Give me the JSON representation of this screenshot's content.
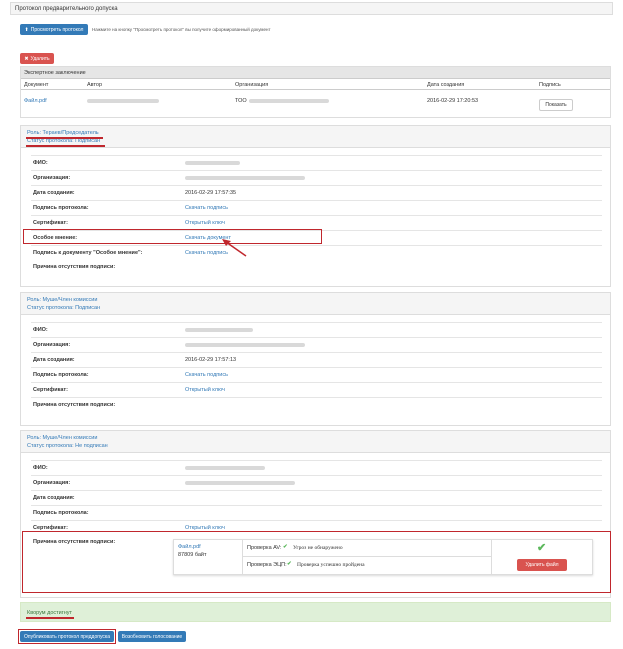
{
  "panel": {
    "title": "Протокол предварительного допуска"
  },
  "toolbar": {
    "view_label": "Просмотреть протокол",
    "view_hint": "Нажмите на кнопку \"Просмотреть протокол\" вы получите оформированный документ"
  },
  "expert": {
    "delete_label": "Удалить",
    "title": "Экспертное заключение",
    "columns": [
      "Документ",
      "Автор",
      "Организация",
      "Дата создания",
      "Подпись"
    ],
    "row": {
      "doc": "Файл.pdf",
      "org_prefix": "ТОО",
      "date": "2016-02-29 17:20:53",
      "sign_label": "Показать"
    }
  },
  "members": [
    {
      "role_label": "Роль:",
      "role_value": "Тераев/Председатель",
      "status_label": "Статус протокола:",
      "status_value": "Подписан",
      "rows": [
        {
          "label": "ФИО:",
          "value": ""
        },
        {
          "label": "Организация:",
          "value": ""
        },
        {
          "label": "Дата создания:",
          "value": "2016-02-29 17:57:35"
        },
        {
          "label": "Подпись протокола:",
          "value": "Скачать подпись"
        },
        {
          "label": "Сертификат:",
          "value": "Открытый ключ"
        },
        {
          "label": "Особое мнение:",
          "value": "Скачать документ"
        },
        {
          "label": "Подпись к документу \"Особое мнение\":",
          "value": "Скачать подпись"
        },
        {
          "label": "Причина отсутствия подписи:",
          "value": ""
        }
      ]
    },
    {
      "role_label": "Роль:",
      "role_value": "Муше/Член комиссии",
      "status_label": "Статус протокола:",
      "status_value": "Подписан",
      "rows": [
        {
          "label": "ФИО:",
          "value": ""
        },
        {
          "label": "Организация:",
          "value": ""
        },
        {
          "label": "Дата создания:",
          "value": "2016-02-29 17:57:13"
        },
        {
          "label": "Подпись протокола:",
          "value": "Скачать подпись"
        },
        {
          "label": "Сертификат:",
          "value": "Открытый ключ"
        },
        {
          "label": "Причина отсутствия подписи:",
          "value": ""
        }
      ]
    },
    {
      "role_label": "Роль:",
      "role_value": "Муше/Член комиссии",
      "status_label": "Статус протокола:",
      "status_value": "Не подписан",
      "rows": [
        {
          "label": "ФИО:",
          "value": ""
        },
        {
          "label": "Организация:",
          "value": ""
        },
        {
          "label": "Дата создания:",
          "value": ""
        },
        {
          "label": "Подпись протокола:",
          "value": ""
        },
        {
          "label": "Сертификат:",
          "value": "Открытый ключ"
        },
        {
          "label": "Причина отсутствия подписи:",
          "value": ""
        }
      ]
    }
  ],
  "upload": {
    "file_name": "Файл.pdf",
    "file_size": "87809 байт",
    "av_label": "Проверка AV:",
    "av_result": "Угроз не обнаружено",
    "eds_label": "Проверка ЭЦП:",
    "eds_result": "Проверка успешно пройдена",
    "delete_label": "Удалить файл"
  },
  "quorum": {
    "text": "Кворум достигнут"
  },
  "footer": {
    "publish_label": "Опубликовать протокол преддопуска",
    "resume_label": "Возобновить голосование"
  },
  "colors": {
    "primary": "#337ab7",
    "danger": "#d9534f",
    "success": "#5cb85c",
    "annotation": "#c0272d"
  }
}
